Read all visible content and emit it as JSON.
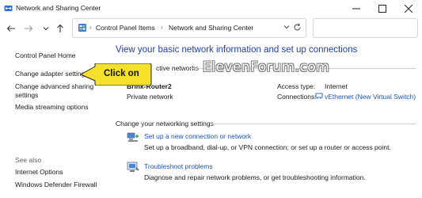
{
  "window": {
    "title": "Network and Sharing Center",
    "minimize_icon": "minimize-icon",
    "maximize_icon": "maximize-icon",
    "close_icon": "close-icon"
  },
  "navigation": {
    "back_icon": "back-arrow-icon",
    "forward_icon": "forward-arrow-icon",
    "recent_icon": "chevron-down-icon",
    "up_icon": "up-arrow-icon"
  },
  "address_bar": {
    "crumbs": [
      "Control Panel Items",
      "Network and Sharing Center"
    ],
    "separator": "›",
    "search_placeholder": ""
  },
  "sidebar": {
    "items": [
      {
        "label": "Control Panel Home"
      },
      {
        "label": "Change adapter settings"
      },
      {
        "label": "Change advanced sharing"
      },
      {
        "label": "settings"
      },
      {
        "label": "Media streaming options"
      }
    ],
    "see_also_heading": "See also",
    "see_also": [
      {
        "label": "Internet Options"
      },
      {
        "label": "Windows Defender Firewall"
      }
    ]
  },
  "main": {
    "heading": "View your basic network information and set up connections",
    "active_networks_label": "ctive networks",
    "network_name": "Brink-Router2",
    "network_type": "Private network",
    "access_type_label": "Access type:",
    "access_type_value": "Internet",
    "connections_label": "Connections:",
    "connections_value": "vEthernet (New Virtual Switch)",
    "change_settings_label": "Change your networking settings",
    "tasks": [
      {
        "title": "Set up a new connection or network",
        "description": "Set up a broadband, dial-up, or VPN connection; or set up a router or access point.",
        "icon": "network-setup-icon"
      },
      {
        "title": "Troubleshoot problems",
        "description": "Diagnose and repair network problems, or get troubleshooting information.",
        "icon": "troubleshoot-icon"
      }
    ]
  },
  "annotation": {
    "callout_text": "Click on",
    "callout_color": "#f5e12a",
    "watermark": "ElevenForum.com"
  },
  "colors": {
    "heading": "#1f3fa8",
    "link": "#1a55c4"
  }
}
